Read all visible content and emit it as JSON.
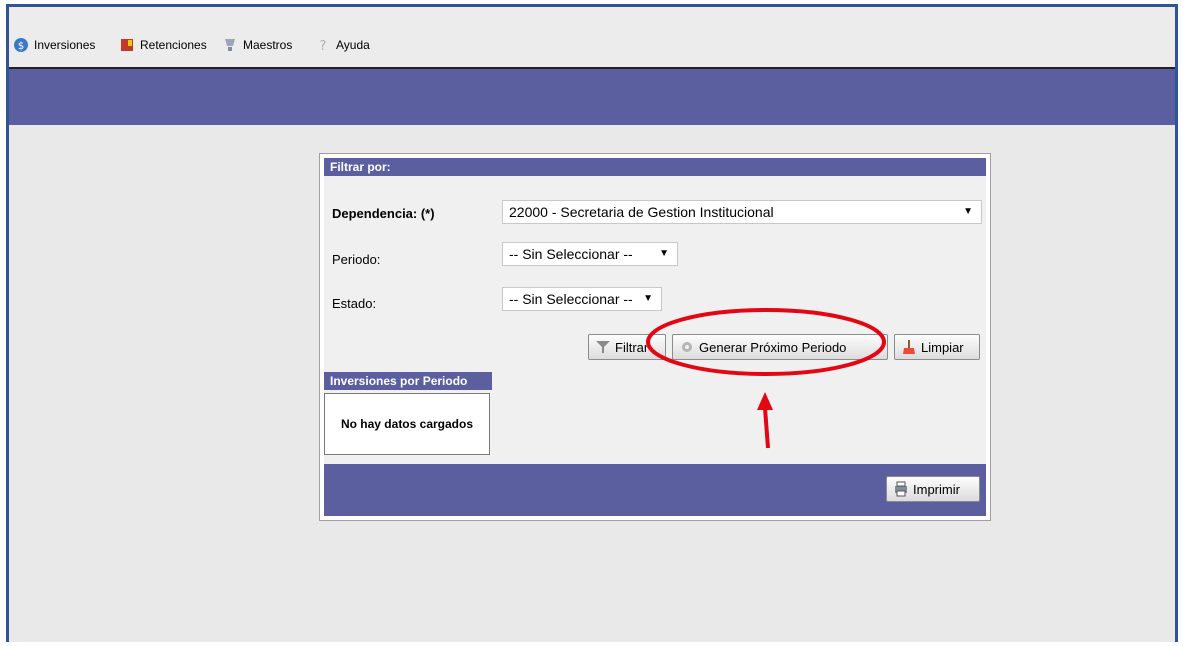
{
  "menu": {
    "items": [
      {
        "label": "Inversiones",
        "icon": "money-icon"
      },
      {
        "label": "Retenciones",
        "icon": "book-icon"
      },
      {
        "label": "Maestros",
        "icon": "trophy-icon"
      },
      {
        "label": "Ayuda",
        "icon": "help-icon"
      }
    ]
  },
  "filter": {
    "title": "Filtrar por:",
    "dependencia_label": "Dependencia: (*)",
    "dependencia_value": "22000 - Secretaria de Gestion Institucional",
    "periodo_label": "Periodo:",
    "periodo_value": "-- Sin Seleccionar --",
    "estado_label": "Estado:",
    "estado_value": "-- Sin Seleccionar --",
    "buttons": {
      "filtrar": "Filtrar",
      "generar": "Generar Próximo Periodo",
      "limpiar": "Limpiar"
    }
  },
  "results": {
    "title": "Inversiones por Periodo",
    "empty_text": "No hay datos cargados",
    "print_label": "Imprimir"
  },
  "colors": {
    "band": "#5b5f9f",
    "annotation": "#e30613"
  }
}
